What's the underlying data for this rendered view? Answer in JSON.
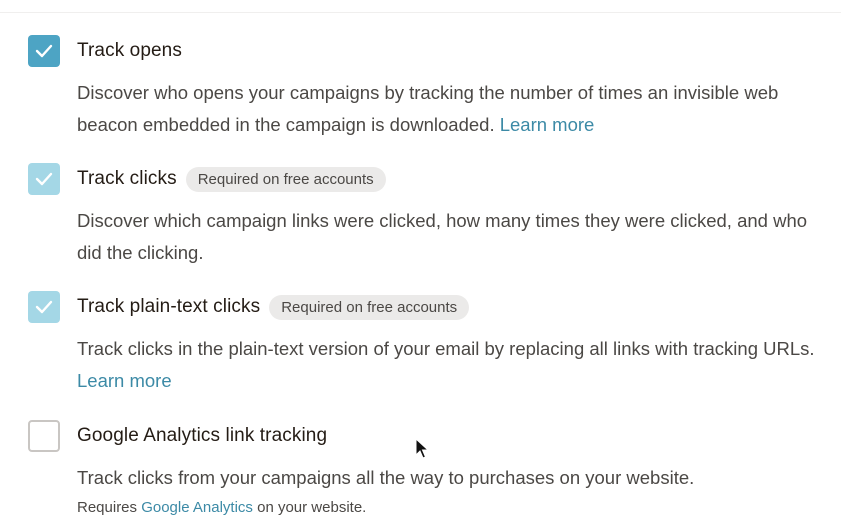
{
  "options": [
    {
      "label": "Track opens",
      "checked": true,
      "description": "Discover who opens your campaigns by tracking the number of times an invisible web beacon embedded in the campaign is downloaded.",
      "link": "Learn more"
    },
    {
      "label": "Track clicks",
      "checked": true,
      "badge": "Required on free accounts",
      "description": "Discover which campaign links were clicked, how many times they were clicked, and who did the clicking."
    },
    {
      "label": "Track plain-text clicks",
      "checked": true,
      "badge": "Required on free accounts",
      "description": "Track clicks in the plain-text version of your email by replacing all links with tracking URLs.",
      "link": "Learn more"
    },
    {
      "label": "Google Analytics link tracking",
      "checked": false,
      "description": "Track clicks from your campaigns all the way to purchases on your website.",
      "note_prefix": "Requires",
      "note_link": "Google Analytics",
      "note_suffix": "on your website."
    }
  ],
  "colors": {
    "checkbox_checked": "#4da4c4",
    "checkbox_checked_disabled": "#a4d7e6",
    "link": "#3c8aa6"
  },
  "icons": {
    "checkmark": "check-icon",
    "cursor": "mouse-pointer-icon"
  }
}
